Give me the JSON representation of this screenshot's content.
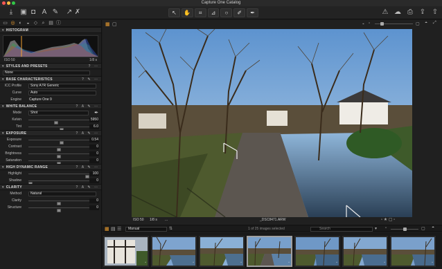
{
  "window": {
    "title": "Capture One Catalog"
  },
  "toolbar": {
    "center_tools": [
      "cursor",
      "hand",
      "crop",
      "straighten",
      "spot",
      "brush",
      "eraser"
    ],
    "right_icons": [
      "warning-icon",
      "cloud-icon",
      "print-icon",
      "export-icon",
      "share-icon"
    ]
  },
  "histogram": {
    "title": "HISTOGRAM",
    "iso": "ISO 50",
    "shutter": "1/8 s"
  },
  "styles": {
    "title": "STYLES AND PRESETS",
    "value": "None"
  },
  "base": {
    "title": "BASE CHARACTERISTICS",
    "icc_label": "ICC Profile",
    "icc_value": "Sony A7R Generic",
    "curve_label": "Curve",
    "curve_value": "Auto",
    "engine_label": "Engine",
    "engine_value": "Capture One 9"
  },
  "wb": {
    "title": "WHITE BALANCE",
    "mode_label": "Mode",
    "mode_value": "Shot",
    "kelvin_label": "Kelvin",
    "kelvin_value": "5950",
    "kelvin_pos": 0.45,
    "tint_label": "Tint",
    "tint_value": "6.0",
    "tint_pos": 0.55
  },
  "exposure": {
    "title": "EXPOSURE",
    "exposure_label": "Exposure",
    "exposure_value": "0.54",
    "exposure_pos": 0.55,
    "contrast_label": "Contrast",
    "contrast_value": "0",
    "contrast_pos": 0.5,
    "brightness_label": "Brightness",
    "brightness_value": "0",
    "brightness_pos": 0.5,
    "saturation_label": "Saturation",
    "saturation_value": "0",
    "saturation_pos": 0.5
  },
  "hdr": {
    "title": "HIGH DYNAMIC RANGE",
    "highlight_label": "Highlight",
    "highlight_value": "100",
    "highlight_pos": 1.0,
    "shadow_label": "Shadow",
    "shadow_value": "0",
    "shadow_pos": 0.0
  },
  "clarity": {
    "title": "CLARITY",
    "method_label": "Method",
    "method_value": "Natural",
    "clarity_label": "Clarity",
    "clarity_value": "0",
    "clarity_pos": 0.5,
    "structure_label": "Structure",
    "structure_value": "0",
    "structure_pos": 0.5
  },
  "viewer": {
    "iso": "ISO 50",
    "shutter": "1/8 s",
    "more": "...",
    "filename": "_DSC8471.ARW"
  },
  "browser": {
    "sort": "Manual",
    "count": "1 of 25 images selected",
    "search_placeholder": "Search"
  },
  "colors": {
    "accent": "#f0a030",
    "panel": "#1e1e1e",
    "background": "#1c1c1c"
  }
}
